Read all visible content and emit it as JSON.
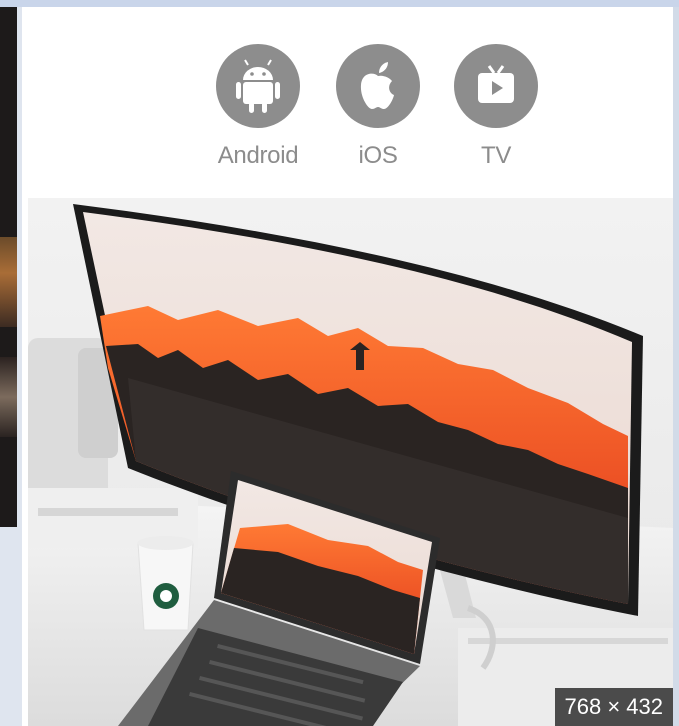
{
  "platforms": [
    {
      "label": "Android",
      "icon": "android-icon"
    },
    {
      "label": "iOS",
      "icon": "apple-icon"
    },
    {
      "label": "TV",
      "icon": "tv-icon"
    }
  ],
  "image": {
    "dimensions": "768 × 432",
    "subject": "curved-monitor-and-laptop-photo"
  },
  "colors": {
    "icon_gray": "#8d8d8d",
    "label_gray": "#8c8c8c",
    "sunset_orange": "#ff5a1f"
  }
}
